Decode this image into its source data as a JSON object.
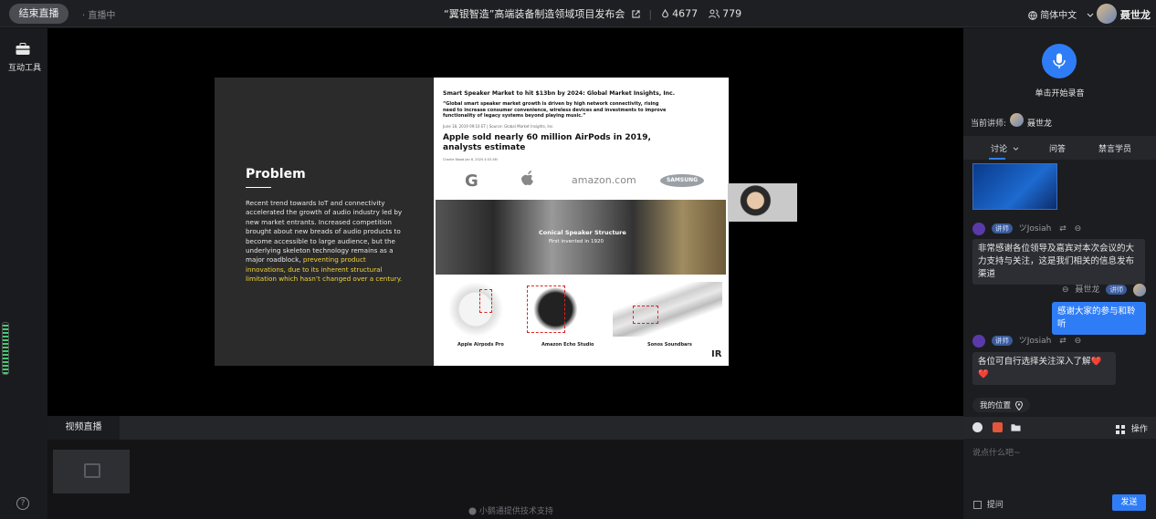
{
  "topbar": {
    "end_live_label": "结束直播",
    "live_status": "· 直播中",
    "title": "“翼银智造”高端装备制造领域项目发布会",
    "likes": "4677",
    "viewers": "779",
    "language": "简体中文",
    "username": "聂世龙"
  },
  "leftbar": {
    "tools_label": "互动工具",
    "help_glyph": "?"
  },
  "slide": {
    "problem_title": "Problem",
    "problem_text": "Recent trend towards IoT and connectivity accelerated the growth of audio industry led by new market entrants. Increased competition brought about new breads of audio products to become accessible to large audience, but the underlying skeleton technology remains as a major roadblock,",
    "problem_highlight": "preventing product innovations, due to its inherent structural limitation which hasn’t changed over a century.",
    "news_headline": "Smart Speaker Market to hit $13bn by 2024: Global Market Insights, Inc.",
    "news_quote": "“Global smart speaker market growth is driven by high network connectivity, rising need to increase consumer convenience, wireless devices and investments to improve functionality of legacy systems beyond playing music.”",
    "news_meta": "June 18, 2019 09:10 ET | Source: Global Market Insights, Inc.",
    "news_headline2": "Apple sold nearly 60 million AirPods in 2019, analysts estimate",
    "news_meta2": "Charlie Wood  Jan 6, 2020 4:03 AM",
    "logo_google": "G",
    "logo_amazon": "amazon.com",
    "logo_samsung": "SAMSUNG",
    "cone_title": "Conical Speaker Structure",
    "cone_sub": "First invented in 1920",
    "product_captions": [
      "Apple Airpods Pro",
      "Amazon Echo Studio",
      "Sonos Soundbars"
    ],
    "ir_logo": "IR"
  },
  "video": {
    "tab_label": "视频直播",
    "support_text": "小鹅通提供技术支持"
  },
  "right": {
    "record_label": "单击开始录音",
    "lecturer_label": "当前讲师:",
    "lecturer_name": "聂世龙",
    "tabs": {
      "discuss": "讨论",
      "qa": "问答",
      "ban": "禁言学员"
    },
    "messages": [
      {
        "badge": "讲师",
        "user": "ツJosiah",
        "text": "非常感谢各位领导及嘉宾对本次会议的大力支持与关注，这是我们相关的信息发布渠道"
      },
      {
        "badge": "讲师",
        "user": "聂世龙",
        "text": "感谢大家的参与和聆听"
      },
      {
        "badge": "讲师",
        "user": "ツJosiah",
        "text": "各位可自行选择关注深入了解❤️❤️"
      }
    ],
    "location_label": "我的位置",
    "ops_label": "操作",
    "input_placeholder": "说点什么吧~",
    "ask_label": "提问",
    "send_label": "发送"
  },
  "colors": {
    "accent": "#2f7df6",
    "meter": "#3bd16f",
    "highlight": "#f2d43a"
  }
}
